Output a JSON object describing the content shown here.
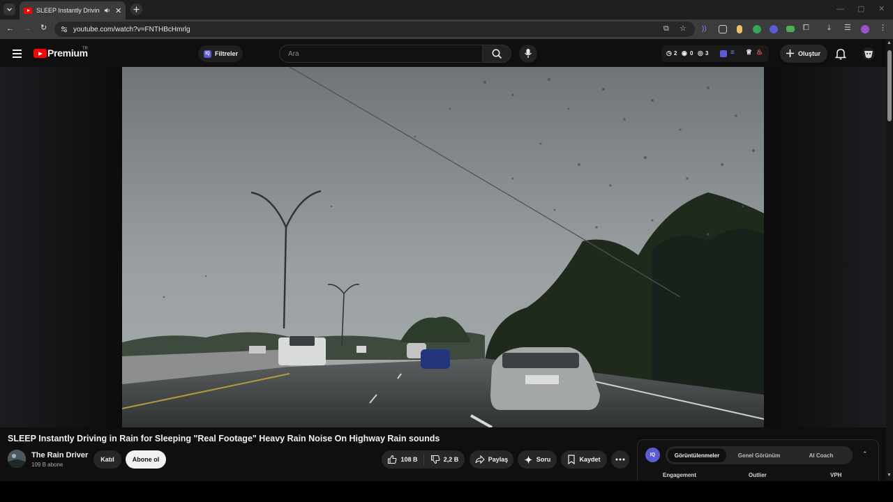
{
  "browser": {
    "tab_title": "SLEEP Instantly Driving in R",
    "url": "youtube.com/watch?v=FNTHBcHmrlg"
  },
  "masthead": {
    "logo_text": "Premium",
    "country_code": "TR",
    "filter_label": "Filtreler",
    "search_placeholder": "Ara",
    "stats": {
      "clock": "2",
      "views": "0",
      "eye": "3"
    },
    "create_label": "Oluştur"
  },
  "video": {
    "title": "SLEEP Instantly Driving in Rain for Sleeping \"Real Footage\" Heavy Rain Noise On Highway Rain sounds",
    "channel_name": "The Rain Driver",
    "subscribers": "109 B abone",
    "join_label": "Katıl",
    "subscribe_label": "Abone ol",
    "like_count": "108 B",
    "dislike_count": "2,2 B",
    "share_label": "Paylaş",
    "ask_label": "Soru",
    "save_label": "Kaydet"
  },
  "iq_panel": {
    "logo": "IQ",
    "tabs": [
      "Görüntülenmeler",
      "Genel Görünüm",
      "AI Coach"
    ],
    "columns": [
      "Engagement",
      "Outlier",
      "VPH"
    ]
  },
  "colors": {
    "youtube_red": "#ff0000",
    "iq_accent": "#5b5bd6",
    "background": "#0f0f0f"
  }
}
